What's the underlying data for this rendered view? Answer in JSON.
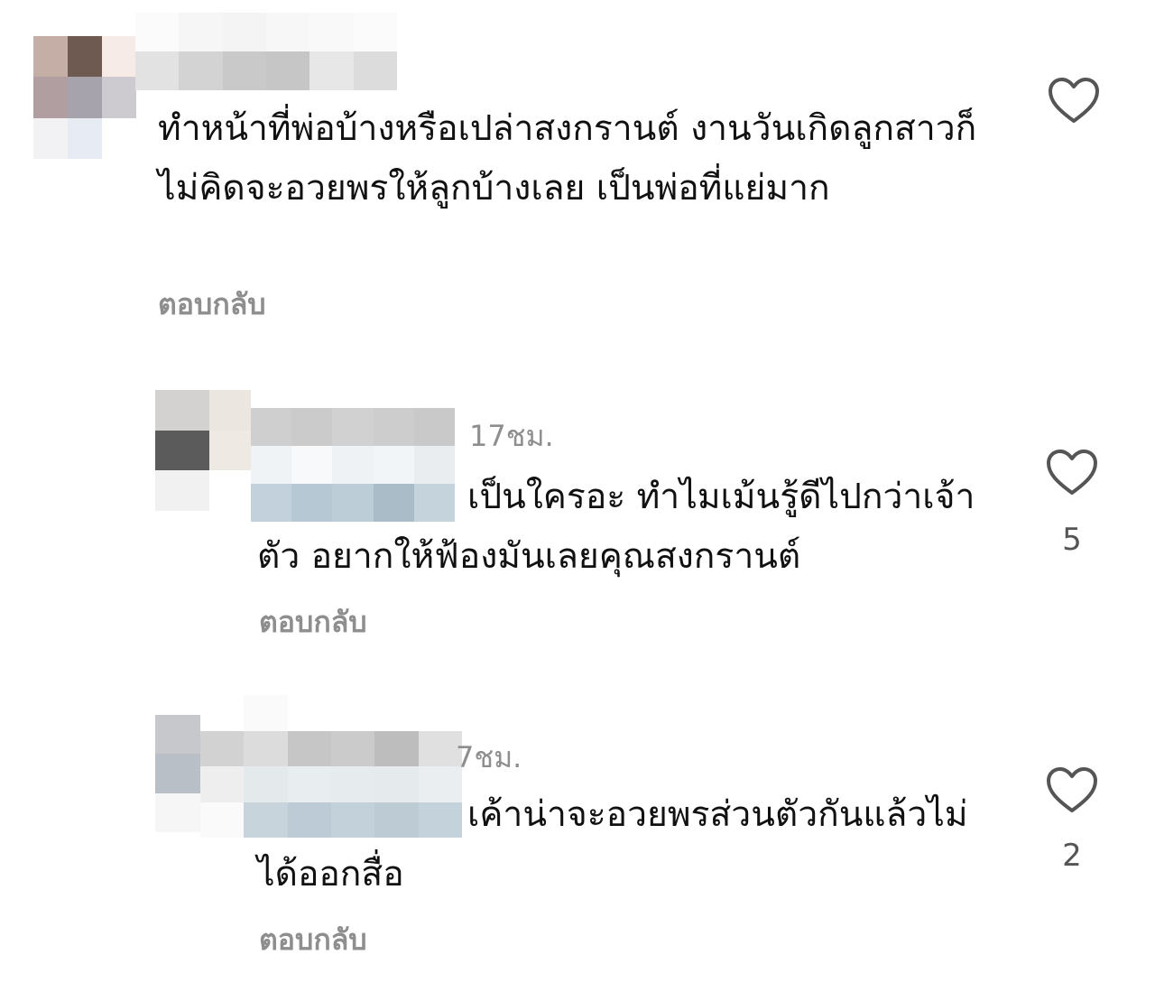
{
  "comments": [
    {
      "time": "",
      "text": "ทำหน้าที่พ่อบ้างหรือเปล่าสงกรานต์ งานวันเกิดลูกสาวก็ไม่คิดจะอวยพรให้ลูกบ้างเลย เป็นพ่อที่แย่มาก",
      "reply_label": "ตอบกลับ",
      "like_count": "",
      "like_icon": "heart-outline-icon"
    },
    {
      "time": "17ชม.",
      "text": "เป็นใครอะ ทำไมเม้นรู้ดีไปกว่าเจ้าตัว อยากให้ฟ้องมันเลยคุณสงกรานต์",
      "reply_label": "ตอบกลับ",
      "like_count": "5",
      "like_icon": "heart-outline-icon"
    },
    {
      "time": "7ชม.",
      "text": "เค้าน่าจะอวยพรส่วนตัวกันแล้วไม่ได้ออกสื่อ",
      "reply_label": "ตอบกลับ",
      "like_count": "2",
      "like_icon": "heart-outline-icon"
    }
  ],
  "colors": {
    "text": "#111111",
    "secondary": "#8e8e8e",
    "heart_stroke": "#555555",
    "background": "#ffffff"
  }
}
